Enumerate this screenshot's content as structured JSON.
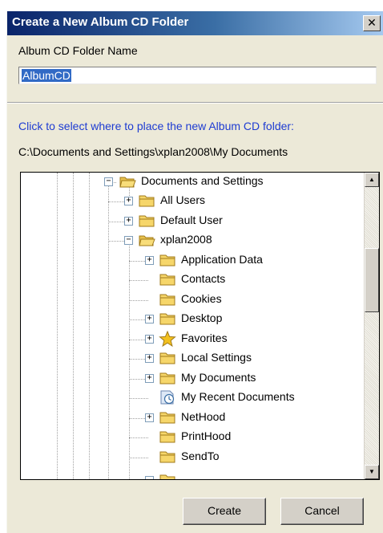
{
  "window": {
    "title": "Create a New Album CD Folder",
    "close_glyph": "✕"
  },
  "form": {
    "name_label": "Album CD Folder Name",
    "name_value": "AlbumCD",
    "location_prompt": "Click to select where to place the new Album CD folder:",
    "current_path": "C:\\Documents and Settings\\xplan2008\\My Documents"
  },
  "tree": {
    "nodes": [
      {
        "label": "Documents and Settings",
        "expander": "−",
        "icon": "folder-icon"
      },
      {
        "label": "All Users",
        "expander": "+",
        "icon": "folder-icon"
      },
      {
        "label": "Default User",
        "expander": "+",
        "icon": "folder-icon"
      },
      {
        "label": "xplan2008",
        "expander": "−",
        "icon": "folder-icon"
      },
      {
        "label": "Application Data",
        "expander": "+",
        "icon": "folder-icon"
      },
      {
        "label": "Contacts",
        "expander": "",
        "icon": "folder-icon"
      },
      {
        "label": "Cookies",
        "expander": "",
        "icon": "folder-icon"
      },
      {
        "label": "Desktop",
        "expander": "+",
        "icon": "folder-icon"
      },
      {
        "label": "Favorites",
        "expander": "+",
        "icon": "star-icon"
      },
      {
        "label": "Local Settings",
        "expander": "+",
        "icon": "folder-icon"
      },
      {
        "label": "My Documents",
        "expander": "+",
        "icon": "folder-icon"
      },
      {
        "label": "My Recent Documents",
        "expander": "",
        "icon": "recent-docs-icon"
      },
      {
        "label": "NetHood",
        "expander": "+",
        "icon": "folder-icon"
      },
      {
        "label": "PrintHood",
        "expander": "",
        "icon": "folder-icon"
      },
      {
        "label": "SendTo",
        "expander": "",
        "icon": "folder-icon"
      }
    ],
    "scroll_up_glyph": "▲",
    "scroll_down_glyph": "▼"
  },
  "buttons": {
    "create": "Create",
    "cancel": "Cancel"
  },
  "colors": {
    "title_gradient_start": "#0a246a",
    "title_gradient_end": "#a6caf0",
    "prompt_text": "#1e3cd2",
    "selection": "#316ac5",
    "dialog_face": "#ece9d8",
    "folder_yellow": "#f6d66a"
  }
}
